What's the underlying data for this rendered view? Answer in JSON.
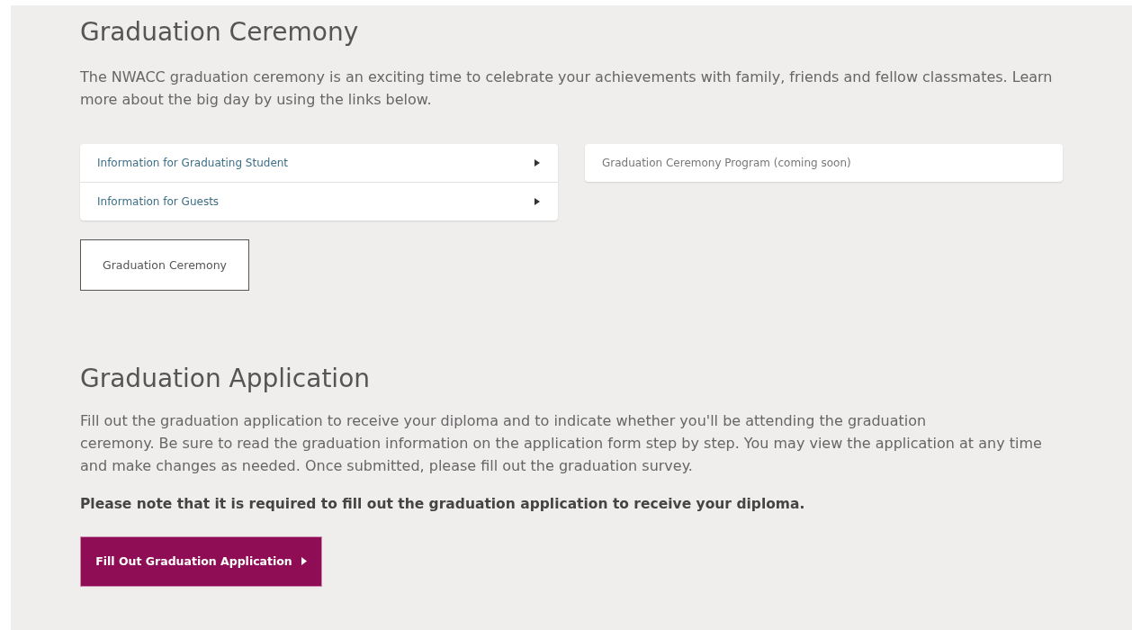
{
  "ceremony": {
    "title": "Graduation Ceremony",
    "intro": "The NWACC graduation ceremony is an exciting time to celebrate your achievements with family, friends and fellow classmates. Learn more about the big day by using the links below.",
    "accordion": [
      {
        "label": "Information for Graduating Student",
        "expanded": false
      },
      {
        "label": "Information for Guests",
        "expanded": false
      }
    ],
    "program": {
      "label": "Graduation Ceremony Program (coming soon)"
    },
    "button": {
      "label": "Graduation Ceremony"
    }
  },
  "application": {
    "title": "Graduation Application",
    "body": "Fill out the graduation application to receive your diploma and to indicate whether you'll be attending the graduation\nceremony. Be sure to read the graduation information on the application form step by step. You may view the application at any time and make changes as needed. Once submitted, please fill out the graduation survey.",
    "note": "Please note that it is required to fill out the graduation application to receive your diploma.",
    "button": {
      "label": "Fill Out Graduation Application"
    }
  }
}
